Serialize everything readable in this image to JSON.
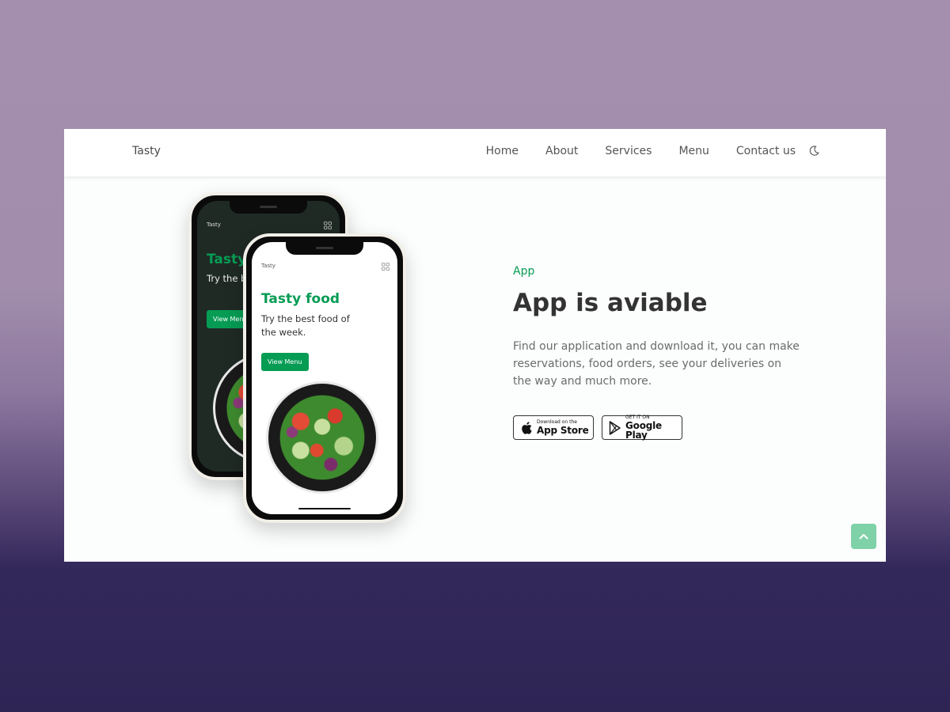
{
  "nav": {
    "brand": "Tasty",
    "links": [
      "Home",
      "About",
      "Services",
      "Menu",
      "Contact us"
    ],
    "theme_icon": "moon-icon"
  },
  "phones": {
    "brand": "Tasty",
    "back": {
      "title": "Tasty",
      "subtitle": "Try the b the weel",
      "button": "View Menu"
    },
    "front": {
      "title": "Tasty food",
      "subtitle": "Try the best food of the week.",
      "button": "View Menu"
    },
    "grid_icon": "grid-icon"
  },
  "section": {
    "eyebrow": "App",
    "headline": "App is aviable",
    "description": "Find our application and download it, you can make reservations, food orders, see your deliveries on the way and much more."
  },
  "stores": {
    "apple": {
      "small": "Download on the",
      "big": "App Store",
      "icon": "apple-icon"
    },
    "google": {
      "small": "GET IT ON",
      "big": "Google Play",
      "icon": "google-play-icon"
    }
  },
  "scroll_top_icon": "chevron-up-icon",
  "colors": {
    "accent": "#069c54",
    "scroll_button": "#7fd1a8",
    "heading": "#333333",
    "text": "#6b6b6b"
  }
}
